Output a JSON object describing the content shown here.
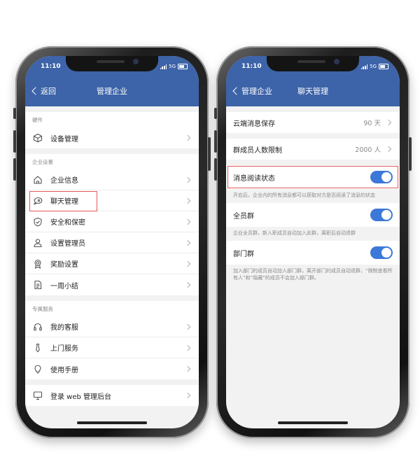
{
  "status_bar": {
    "time": "11:10",
    "network": "5G"
  },
  "left": {
    "back_label": "返回",
    "title": "管理企业",
    "sections": [
      {
        "header": "硬件",
        "items": [
          {
            "label": "设备管理",
            "icon": "cube-icon"
          }
        ]
      },
      {
        "header": "企业设置",
        "items": [
          {
            "label": "企业信息",
            "icon": "home-icon"
          },
          {
            "label": "聊天管理",
            "icon": "chat-bubble-icon",
            "highlighted": true
          },
          {
            "label": "安全和保密",
            "icon": "shield-check-icon"
          },
          {
            "label": "设置管理员",
            "icon": "admin-user-icon"
          },
          {
            "label": "奖励设置",
            "icon": "award-badge-icon"
          },
          {
            "label": "一周小结",
            "icon": "weekly-report-icon"
          }
        ]
      },
      {
        "header": "专属服务",
        "items": [
          {
            "label": "我的客服",
            "icon": "headset-icon"
          },
          {
            "label": "上门服务",
            "icon": "tie-icon"
          },
          {
            "label": "使用手册",
            "icon": "lightbulb-icon"
          }
        ]
      }
    ],
    "web_item": {
      "label": "登录 web 管理后台",
      "icon": "monitor-icon"
    }
  },
  "right": {
    "back_label": "管理企业",
    "title": "聊天管理",
    "cloud_storage": {
      "label": "云端消息保存",
      "value": "90 天"
    },
    "group_limit": {
      "label": "群成员人数限制",
      "value": "2000 人"
    },
    "read_status": {
      "label": "消息阅读状态",
      "on": true,
      "desc": "开启后，企业内的所有消息都可以获取对方是否阅读了消息的状态"
    },
    "all_staff": {
      "label": "全员群",
      "on": true,
      "desc": "企业全员群，新入职成员自动加入此群，离职后自动退群"
    },
    "dept": {
      "label": "部门群",
      "on": true,
      "desc": "加入部门的成员自动加入部门群，离开部门的成员自动退群，“限制查看所有人”和“隐藏”的成员不会加入部门群。"
    }
  },
  "colors": {
    "header_blue": "#3d63a8",
    "toggle_blue": "#3b78d8",
    "highlight_red": "#e25b5b",
    "icon_gray": "#555555"
  }
}
